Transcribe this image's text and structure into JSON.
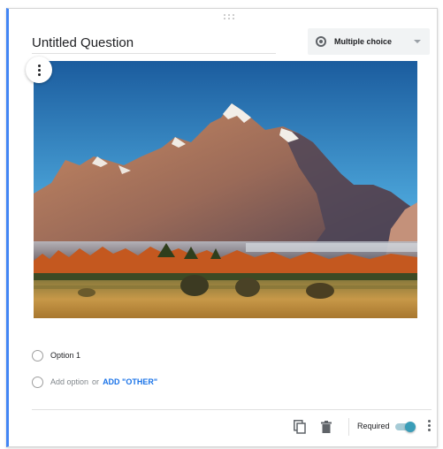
{
  "question": {
    "title": "Untitled Question",
    "type_label": "Multiple choice",
    "type_icon": "radio-button-icon"
  },
  "image": {
    "menu_icon": "more-vertical-icon",
    "subject": "mountain-landscape"
  },
  "options": [
    {
      "label": "Option 1"
    }
  ],
  "add_option": {
    "label": "Add option",
    "or_text": "or",
    "other_label": "ADD \"OTHER\""
  },
  "footer": {
    "duplicate_icon": "copy-icon",
    "delete_icon": "trash-icon",
    "required_label": "Required",
    "required_on": true,
    "more_icon": "more-vertical-icon"
  },
  "colors": {
    "accent": "#4285f4",
    "link": "#1a73e8",
    "toggle": "#3a9db8"
  }
}
